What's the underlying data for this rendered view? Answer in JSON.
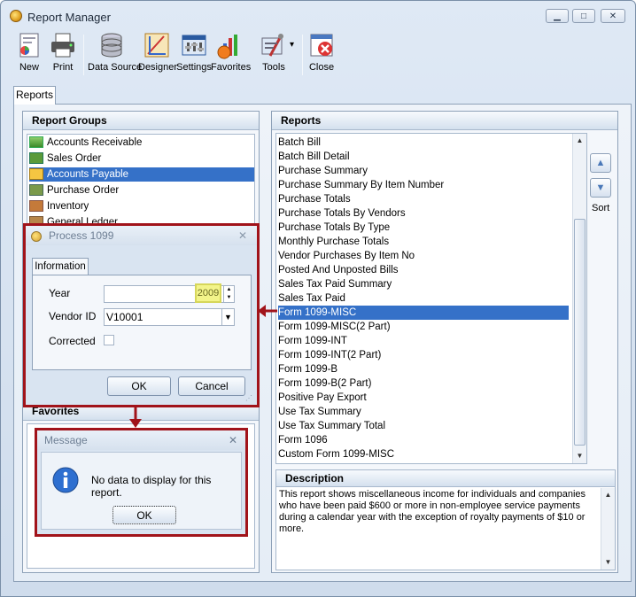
{
  "window": {
    "title": "Report Manager",
    "controls": {
      "minimize": "▁",
      "maximize": "□",
      "close": "✕"
    }
  },
  "toolbar": {
    "items": [
      {
        "label": "New",
        "icon": "new-report-icon"
      },
      {
        "label": "Print",
        "icon": "printer-icon"
      },
      {
        "label": "Data Source",
        "icon": "database-icon"
      },
      {
        "label": "Designer",
        "icon": "designer-icon"
      },
      {
        "label": "Settings",
        "icon": "settings-icon"
      },
      {
        "label": "Favorites",
        "icon": "favorites-chart-icon"
      },
      {
        "label": "Tools",
        "icon": "tools-icon"
      },
      {
        "label": "Close",
        "icon": "close-form-icon"
      }
    ],
    "tools_dropdown": "▾"
  },
  "tabs": {
    "reports": "Reports"
  },
  "report_groups": {
    "header": "Report Groups",
    "items": [
      "Accounts Receivable",
      "Sales Order",
      "Accounts Payable",
      "Purchase Order",
      "Inventory",
      "General Ledger"
    ],
    "selected_index": 2
  },
  "favorites": {
    "header": "Favorites"
  },
  "reports": {
    "header": "Reports",
    "items": [
      "Batch Bill",
      "Batch Bill Detail",
      "Purchase Summary",
      "Purchase Summary By Item Number",
      "Purchase Totals",
      "Purchase Totals By Vendors",
      "Purchase Totals By Type",
      "Monthly Purchase Totals",
      "Vendor Purchases By Item No",
      "Posted And Unposted Bills",
      "Sales Tax Paid Summary",
      "Sales Tax Paid",
      "Form 1099-MISC",
      "Form 1099-MISC(2 Part)",
      "Form 1099-INT",
      "Form 1099-INT(2 Part)",
      "Form 1099-B",
      "Form 1099-B(2 Part)",
      "Positive Pay Export",
      "Use Tax Summary",
      "Use Tax Summary Total",
      "Form 1096",
      "Custom Form 1099-MISC"
    ],
    "selected_index": 12
  },
  "sort": {
    "label": "Sort",
    "up": "▲",
    "down": "▼"
  },
  "description": {
    "header": "Description",
    "text": "This report shows miscellaneous income for individuals and companies who have been paid $600 or more in non-employee service payments during a calendar year with the exception of royalty payments of $10 or more."
  },
  "process_dialog": {
    "title": "Process 1099",
    "close": "✕",
    "tab": "Information",
    "year_label": "Year",
    "year_value": "2009",
    "vendor_label": "Vendor ID",
    "vendor_value": "V10001",
    "corrected_label": "Corrected",
    "ok": "OK",
    "cancel": "Cancel"
  },
  "message_dialog": {
    "title": "Message",
    "close": "✕",
    "text": "No data to display for this report.",
    "ok": "OK"
  },
  "colors": {
    "selection": "#3571c8",
    "highlight_frame": "#a1131a",
    "year_highlight": "#f3f48a"
  }
}
